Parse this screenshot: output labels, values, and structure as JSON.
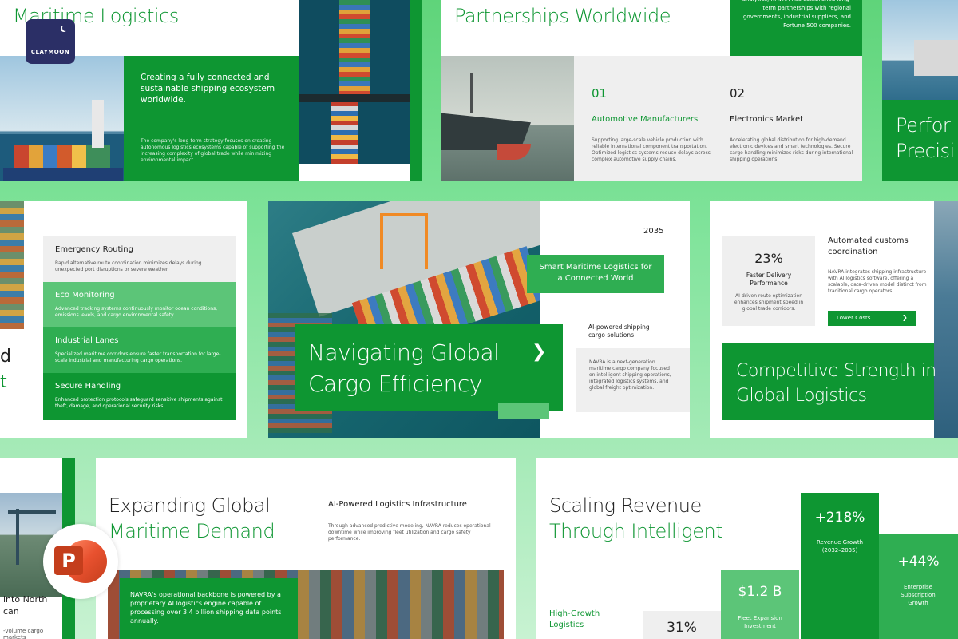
{
  "colors": {
    "brand": "#0e9632",
    "brand_mid": "#2fae52",
    "brand_light": "#5cc578",
    "gray": "#efefef"
  },
  "badge": {
    "logo_text": "CLAYMOON",
    "icon": "moon-icon"
  },
  "slide1": {
    "title_line2": "Maritime Logistics",
    "lead": "Creating a fully connected and sustainable shipping ecosystem worldwide.",
    "body": "The company's long-term strategy focuses on creating autonomous logistics ecosystems capable of supporting the increasing complexity of global trade while minimizing environmental impact."
  },
  "slide2": {
    "title_line2": "Partnerships Worldwide",
    "top_text": "analytics, NAVRA has established long-term partnerships with regional governments, industrial suppliers, and Fortune 500 companies.",
    "items": [
      {
        "num": "01",
        "heading": "Automotive Manufacturers",
        "body": "Supporting large-scale vehicle production with reliable international component transportation. Optimized logistics systems reduce delays across complex automotive supply chains."
      },
      {
        "num": "02",
        "heading": "Electronics Market",
        "body": "Accelerating global distribution for high-demand electronic devices and smart technologies. Secure cargo handling minimizes risks during international shipping operations."
      }
    ]
  },
  "slide3": {
    "title_line1": "Perfor",
    "title_line2": "Precisi"
  },
  "slide4": {
    "left_letters": [
      "d",
      "t"
    ],
    "items": [
      {
        "heading": "Emergency Routing",
        "body": "Rapid alternative route coordination minimizes delays during unexpected port disruptions or severe weather."
      },
      {
        "heading": "Eco Monitoring",
        "body": "Advanced tracking systems continuously monitor ocean conditions, emissions levels, and cargo environmental safety."
      },
      {
        "heading": "Industrial Lanes",
        "body": "Specialized maritime corridors ensure faster transportation for large-scale industrial and manufacturing cargo operations."
      },
      {
        "heading": "Secure Handling",
        "body": "Enhanced protection protocols safeguard sensitive shipments against theft, damage, and operational security risks."
      }
    ]
  },
  "slide5": {
    "year": "2035",
    "tag": "Smart Maritime Logistics for a Connected World",
    "title": "Navigating Global Cargo Efficiency",
    "arrow": "❯",
    "sub_heading": "AI-powered shipping cargo solutions",
    "body": "NAVRA is a next-generation maritime cargo company focused on intelligent shipping operations, integrated logistics systems, and global freight optimization."
  },
  "slide6": {
    "stat": "23%",
    "stat_label": "Faster Delivery Performance",
    "stat_body": "AI-driven route optimization enhances shipment speed in global trade corridors.",
    "heading": "Automated customs coordination",
    "body": "NAVRA integrates shipping infrastructure with AI logistics software, offering a scalable, data-driven model distinct from traditional cargo operators.",
    "button": "Lower Costs",
    "button_arrow": "❯",
    "title": "Competitive Strength in Global Logistics"
  },
  "slide7": {
    "title_line1": "into North",
    "title_line2": "can",
    "body_line1": "-volume cargo markets"
  },
  "slide8": {
    "title_line1": "Expanding Global",
    "title_line2": "Maritime Demand",
    "heading": "AI-Powered Logistics Infrastructure",
    "body": "Through advanced predictive modeling, NAVRA reduces operational downtime while improving fleet utilization and cargo safety performance.",
    "callout": "NAVRA's operational backbone is powered by a proprietary AI logistics engine capable of processing over 3.4 billion shipping data points annually."
  },
  "slide9": {
    "title_line1": "Scaling Revenue",
    "title_line2": "Through Intelligent",
    "side_label": "High-Growth Logistics",
    "bars": [
      {
        "value": "31%",
        "label": ""
      },
      {
        "value": "$1.2 B",
        "label": "Fleet Expansion Investment"
      },
      {
        "value": "+218%",
        "label": "Revenue Growth (2032–2035)"
      },
      {
        "value": "+44%",
        "label": "Enterprise Subscription Growth"
      }
    ]
  },
  "ppt_icon": {
    "letter": "P",
    "icon": "powerpoint-icon"
  }
}
